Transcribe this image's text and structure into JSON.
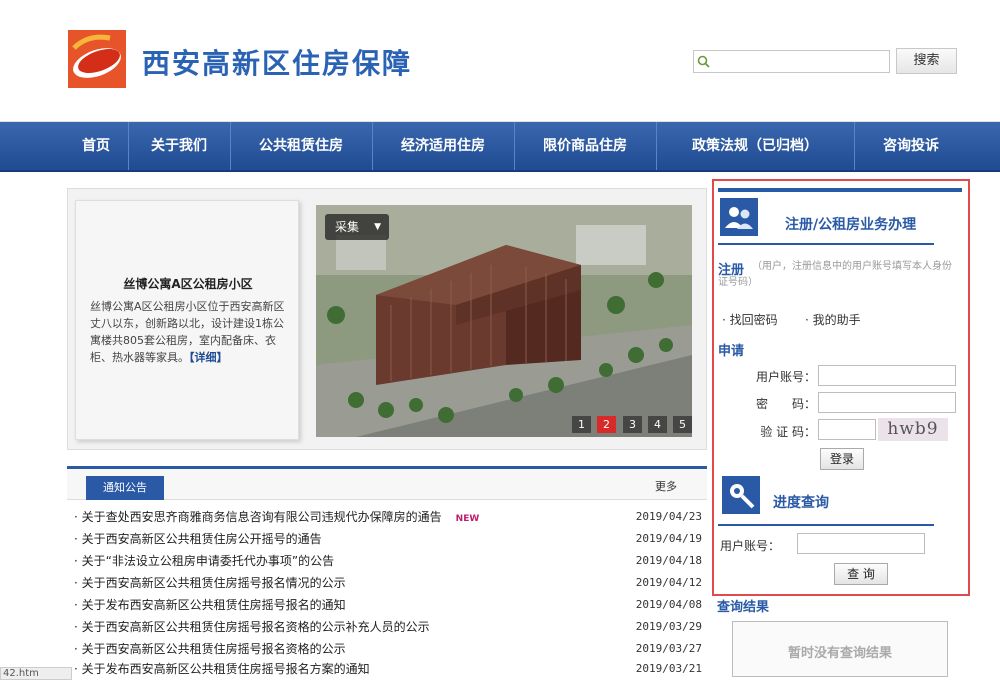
{
  "header": {
    "site_title": "西安高新区住房保障",
    "search_placeholder": "",
    "search_button": "搜索"
  },
  "nav": {
    "items": [
      {
        "label": "首页"
      },
      {
        "label": "关于我们"
      },
      {
        "label": "公共租赁住房"
      },
      {
        "label": "经济适用住房"
      },
      {
        "label": "限价商品住房"
      },
      {
        "label": "政策法规（已归档）"
      },
      {
        "label": "咨询投诉"
      }
    ]
  },
  "slider": {
    "caption_title": "丝博公寓A区公租房小区",
    "caption_text": "丝博公寓A区公租房小区位于西安高新区丈八以东，创新路以北，设计建设1栋公寓楼共805套公租房，室内配备床、衣柜、热水器等家具。",
    "more_label": "【详细】",
    "photo_tag": "采集",
    "pages": [
      "1",
      "2",
      "3",
      "4",
      "5"
    ],
    "active_page": "2"
  },
  "notices": {
    "tab_label": "通知公告",
    "more_label": "更多",
    "new_badge": "NEW",
    "items": [
      {
        "title": "关于查处西安思齐商雅商务信息咨询有限公司违规代办保障房的通告",
        "date": "2019/04/23",
        "is_new": true
      },
      {
        "title": "关于西安高新区公共租赁住房公开摇号的通告",
        "date": "2019/04/19",
        "is_new": false
      },
      {
        "title": "关于“非法设立公租房申请委托代办事项”的公告",
        "date": "2019/04/18",
        "is_new": false
      },
      {
        "title": "关于西安高新区公共租赁住房摇号报名情况的公示",
        "date": "2019/04/12",
        "is_new": false
      },
      {
        "title": "关于发布西安高新区公共租赁住房摇号报名的通知",
        "date": "2019/04/08",
        "is_new": false
      },
      {
        "title": "关于西安高新区公共租赁住房摇号报名资格的公示补充人员的公示",
        "date": "2019/03/29",
        "is_new": false
      },
      {
        "title": "关于西安高新区公共租赁住房摇号报名资格的公示",
        "date": "2019/03/27",
        "is_new": false
      },
      {
        "title": "关于发布西安高新区公共租赁住房摇号报名方案的通知",
        "date": "2019/03/21",
        "is_new": false
      }
    ]
  },
  "sidebar": {
    "register_title": "注册/公租房业务办理",
    "register_label": "注册",
    "register_hint": "（用户，注册信息中的用户账号填写本人身份证号码）",
    "find_password": "· 找回密码",
    "helper": "· 我的助手",
    "apply_label": "申请",
    "username_label": "用户账号：",
    "password_label": "密　　码：",
    "captcha_label": "验  证  码：",
    "captcha_text": "hwb9",
    "login_button": "登录",
    "progress_title": "进度查询",
    "account_label": "用户账号：",
    "query_button": "查 询",
    "result_title": "查询结果",
    "result_text": "暂时没有查询结果"
  },
  "statusbar": {
    "text": "42.htm"
  },
  "colors": {
    "nav_blue": "#2a5aa6",
    "highlight_red": "#e04a4a",
    "active_pager": "#d92a2a"
  }
}
